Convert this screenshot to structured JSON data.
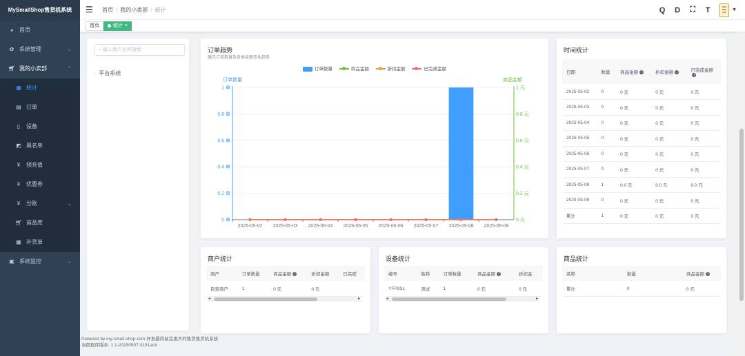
{
  "app": {
    "title": "MySmallShop售货机系统"
  },
  "sidebar": {
    "items": [
      {
        "label": "首页",
        "icon": "dashboard-icon"
      },
      {
        "label": "系统管理",
        "icon": "gear-icon"
      },
      {
        "label": "我的小卖部",
        "icon": "cart-icon"
      },
      {
        "label": "统计",
        "icon": "chart-icon"
      },
      {
        "label": "订单",
        "icon": "order-icon"
      },
      {
        "label": "设备",
        "icon": "device-icon"
      },
      {
        "label": "黑名单",
        "icon": "blacklist-icon"
      },
      {
        "label": "预充值",
        "icon": "yen-icon"
      },
      {
        "label": "优惠券",
        "icon": "yen-icon"
      },
      {
        "label": "分账",
        "icon": "yen-icon"
      },
      {
        "label": "商品库",
        "icon": "cart-icon"
      },
      {
        "label": "补货单",
        "icon": "table-icon"
      },
      {
        "label": "系统监控",
        "icon": "monitor-icon"
      }
    ],
    "active_color": "#409eff"
  },
  "breadcrumb": [
    "首页",
    "我的小卖部",
    "统计"
  ],
  "header": {
    "tools": [
      "Q",
      "D",
      "⛶",
      "T"
    ]
  },
  "tags": {
    "home": "首页",
    "current": "统计"
  },
  "tree": {
    "placeholder": "输入商户名称搜索",
    "root": "平台系统"
  },
  "trend": {
    "title": "订单趋势",
    "subtitle": "展示订单数量及各类金额变化趋势",
    "legend": [
      "订单数量",
      "商品金额",
      "折扣金额",
      "已完成金额"
    ],
    "left_axis_name": "订单数量",
    "right_axis_name": "商品金额"
  },
  "chart_data": {
    "type": "bar",
    "categories": [
      "2025-05-02",
      "2025-05-03",
      "2025-05-04",
      "2025-05-05",
      "2025-05-06",
      "2025-05-07",
      "2025-05-08",
      "2025-05-09"
    ],
    "series": [
      {
        "name": "订单数量",
        "type": "bar",
        "axis": "left",
        "color": "#409eff",
        "values": [
          0,
          0,
          0,
          0,
          0,
          0,
          1,
          0
        ]
      },
      {
        "name": "商品金额",
        "type": "line",
        "axis": "right",
        "color": "#67c23a",
        "values": [
          0,
          0,
          0,
          0,
          0,
          0,
          0,
          0
        ]
      },
      {
        "name": "折扣金额",
        "type": "line",
        "axis": "right",
        "color": "#e6a23c",
        "values": [
          0,
          0,
          0,
          0,
          0,
          0,
          0,
          0
        ]
      },
      {
        "name": "已完成金额",
        "type": "line",
        "axis": "right",
        "color": "#f56c6c",
        "values": [
          0,
          0,
          0,
          0,
          0,
          0,
          0,
          0
        ]
      }
    ],
    "left_ticks": [
      "0 单",
      "0.2 单",
      "0.4 单",
      "0.6 单",
      "0.8 单",
      "1 单"
    ],
    "right_ticks": [
      "0 元",
      "0.2 元",
      "0.4 元",
      "0.6 元",
      "0.8 元",
      "1 元"
    ],
    "ylim": [
      0,
      1
    ],
    "left_axis_color": "#409eff",
    "right_axis_color": "#67c23a"
  },
  "time_stats": {
    "title": "时间统计",
    "headers": [
      "日期",
      "数量",
      "商品金额",
      "折扣金额",
      "已完成金额"
    ],
    "rows": [
      [
        "2025-05-02",
        "0",
        "0 元",
        "0 元",
        "0 元"
      ],
      [
        "2025-05-03",
        "0",
        "0 元",
        "0 元",
        "0 元"
      ],
      [
        "2025-05-04",
        "0",
        "0 元",
        "0 元",
        "0 元"
      ],
      [
        "2025-05-05",
        "0",
        "0 元",
        "0 元",
        "0 元"
      ],
      [
        "2025-05-06",
        "0",
        "0 元",
        "0 元",
        "0 元"
      ],
      [
        "2025-05-07",
        "0",
        "0 元",
        "0 元",
        "0 元"
      ],
      [
        "2025-05-08",
        "1",
        "0.0 元",
        "0.0 元",
        "0.0 元"
      ],
      [
        "2025-05-09",
        "0",
        "0 元",
        "0 元",
        "0 元"
      ],
      [
        "累计",
        "1",
        "0 元",
        "0 元",
        "0 元"
      ]
    ]
  },
  "merchant_stats": {
    "title": "商户统计",
    "headers": [
      "商户",
      "订单数量",
      "商品金额",
      "折扣金额",
      "已完成"
    ],
    "rows": [
      [
        "自营商户",
        "1",
        "0 元",
        "0 元",
        ""
      ]
    ]
  },
  "device_stats": {
    "title": "设备统计",
    "headers": [
      "编号",
      "名称",
      "订单数量",
      "商品金额",
      "折扣金"
    ],
    "rows": [
      [
        "YFP9SL",
        "测试",
        "1",
        "0 元",
        "0 元"
      ]
    ]
  },
  "product_stats": {
    "title": "商品统计",
    "headers": [
      "名称",
      "数量",
      "商品金额"
    ],
    "rows": [
      [
        "累计",
        "0",
        "0 元"
      ]
    ]
  },
  "footer": {
    "line1": "Powered by my-small-shop.com 开发最简易完善大的售货售货机系统",
    "line2": "当前程序版本: 1.1-20250507-3181acb"
  }
}
